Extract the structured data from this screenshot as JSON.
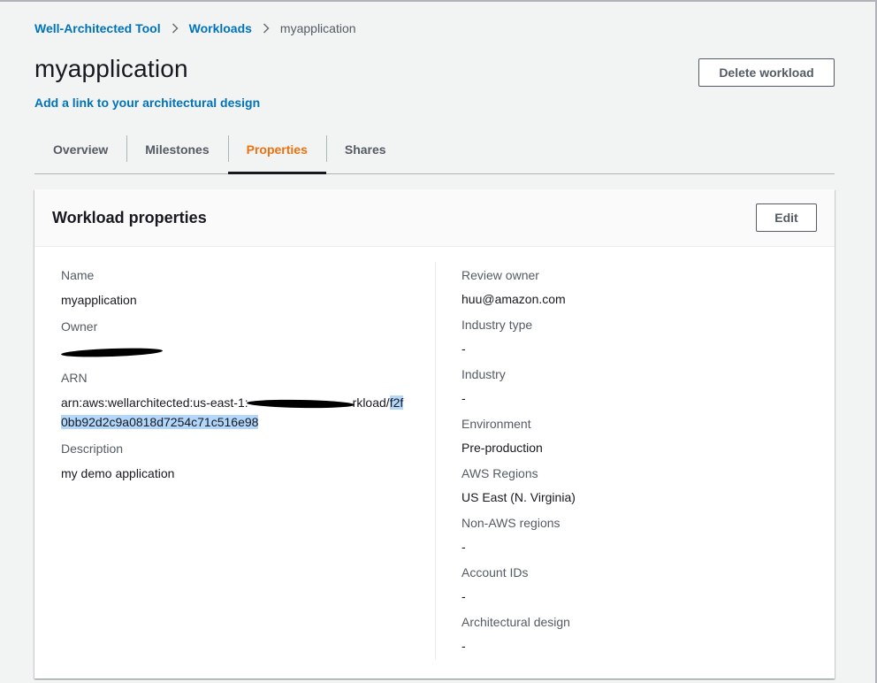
{
  "breadcrumb": {
    "root": "Well-Architected Tool",
    "workloads": "Workloads",
    "current": "myapplication"
  },
  "header": {
    "title": "myapplication",
    "design_link": "Add a link to your architectural design",
    "delete_label": "Delete workload"
  },
  "tabs": [
    {
      "label": "Overview"
    },
    {
      "label": "Milestones"
    },
    {
      "label": "Properties",
      "active": true
    },
    {
      "label": "Shares"
    }
  ],
  "panel": {
    "title": "Workload properties",
    "edit_label": "Edit",
    "left": {
      "name_label": "Name",
      "name_value": "myapplication",
      "owner_label": "Owner",
      "arn_label": "ARN",
      "arn_part1": "arn:aws:wellarchitected:us-east-1:",
      "arn_part2": "rkload/",
      "arn_highlight": "f2f0bb92d2c9a0818d7254c71c516e98",
      "description_label": "Description",
      "description_value": "my demo application"
    },
    "right": {
      "review_owner_label": "Review owner",
      "review_owner_value": "huu@amazon.com",
      "industry_type_label": "Industry type",
      "industry_type_value": "-",
      "industry_label": "Industry",
      "industry_value": "-",
      "environment_label": "Environment",
      "environment_value": "Pre-production",
      "aws_regions_label": "AWS Regions",
      "aws_regions_value": "US East (N. Virginia)",
      "non_aws_label": "Non-AWS regions",
      "non_aws_value": "-",
      "account_ids_label": "Account IDs",
      "account_ids_value": "-",
      "arch_design_label": "Architectural design",
      "arch_design_value": "-"
    }
  },
  "colors": {
    "link": "#0073bb",
    "active_tab": "#ec7211",
    "highlight": "#b3d7fb"
  }
}
